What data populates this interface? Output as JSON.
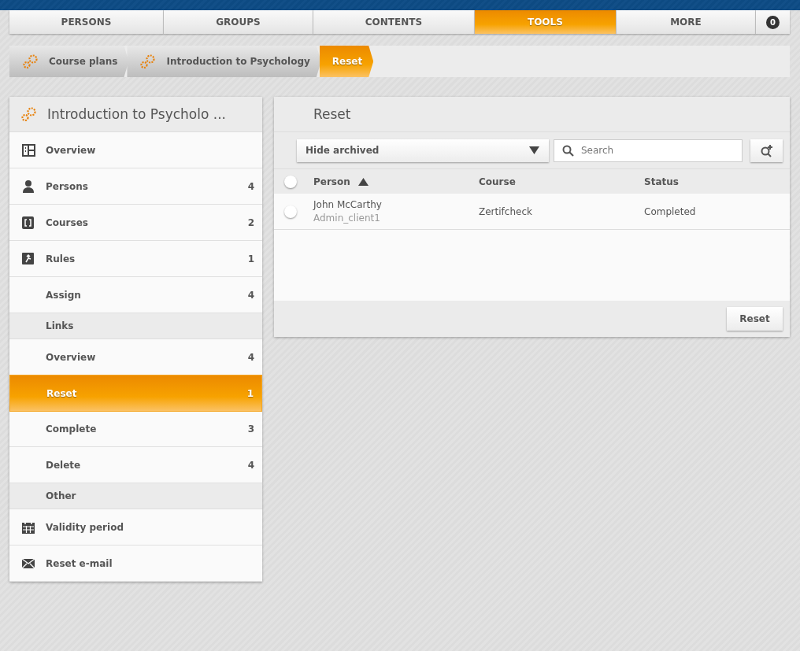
{
  "nav": {
    "tabs": [
      {
        "label": "PERSONS",
        "selected": false
      },
      {
        "label": "GROUPS",
        "selected": false
      },
      {
        "label": "CONTENTS",
        "selected": false
      },
      {
        "label": "TOOLS",
        "selected": true
      },
      {
        "label": "MORE",
        "selected": false
      }
    ],
    "badge": "0"
  },
  "breadcrumb": [
    {
      "label": "Course plans",
      "selected": false,
      "gear": true
    },
    {
      "label": "Introduction to Psychology",
      "selected": false,
      "gear": true
    },
    {
      "label": "Reset",
      "selected": true,
      "gear": false
    }
  ],
  "sidebar": {
    "title": "Introduction to Psycholo ...",
    "items": [
      {
        "kind": "item",
        "label": "Overview",
        "selected": false
      },
      {
        "kind": "item",
        "label": "Persons",
        "count": "4",
        "selected": false
      },
      {
        "kind": "item",
        "label": "Courses",
        "count": "2",
        "selected": false
      },
      {
        "kind": "item",
        "label": "Rules",
        "count": "1",
        "selected": false
      },
      {
        "kind": "item",
        "label": "Assign",
        "count": "4",
        "selected": false
      },
      {
        "kind": "section",
        "label": "Links"
      },
      {
        "kind": "item",
        "label": "Overview",
        "count": "4",
        "selected": false
      },
      {
        "kind": "item",
        "label": "Reset",
        "count": "1",
        "selected": true
      },
      {
        "kind": "item",
        "label": "Complete",
        "count": "3",
        "selected": false
      },
      {
        "kind": "item",
        "label": "Delete",
        "count": "4",
        "selected": false
      },
      {
        "kind": "section",
        "label": "Other"
      },
      {
        "kind": "item",
        "label": "Validity period",
        "selected": false
      },
      {
        "kind": "item",
        "label": "Reset e-mail",
        "selected": false
      }
    ]
  },
  "panel": {
    "title": "Reset",
    "filter": "Hide archived",
    "search": {
      "placeholder": "Search"
    },
    "table": {
      "select_all": {
        "checked": false
      },
      "columns": [
        {
          "label": "Person",
          "sorted": true
        },
        {
          "label": "Course",
          "sorted": false
        },
        {
          "label": "Status",
          "sorted": false
        }
      ],
      "rows": [
        {
          "checked": false,
          "person": "John McCarthy",
          "client": "Admin_client1",
          "course": "Zertifcheck",
          "status": "Completed"
        }
      ]
    },
    "button": "Reset"
  }
}
